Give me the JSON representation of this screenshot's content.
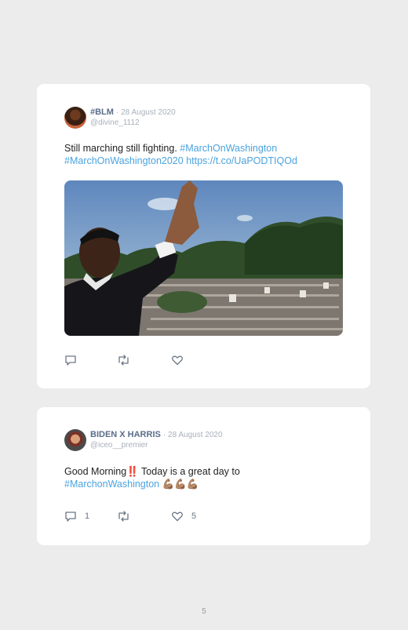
{
  "tweets": [
    {
      "name": "#BLM",
      "date": "· 28 August 2020",
      "handle": "@divine_1112",
      "text": "Still marching still fighting.",
      "hashtags": [
        "#MarchOnWashington",
        "#MarchOnWashington2020"
      ],
      "link": "https://t.co/UaPODTIQOd",
      "reply_count": "",
      "retweet_count": "",
      "like_count": ""
    },
    {
      "name": "BIDEN X HARRIS",
      "date": "· 28 August 2020",
      "handle": "@iceo__premier",
      "text_before": "Good Morning",
      "emoji_bang": "‼️",
      "text_after": " Today is a great day to",
      "hashtag": "#MarchonWashington",
      "emoji_arms": "💪🏽💪🏽💪🏽",
      "reply_count": "1",
      "retweet_count": "",
      "like_count": "5"
    }
  ],
  "icons": {
    "reply": "reply-icon",
    "retweet": "retweet-icon",
    "like": "heart-icon"
  },
  "page_number": "5"
}
